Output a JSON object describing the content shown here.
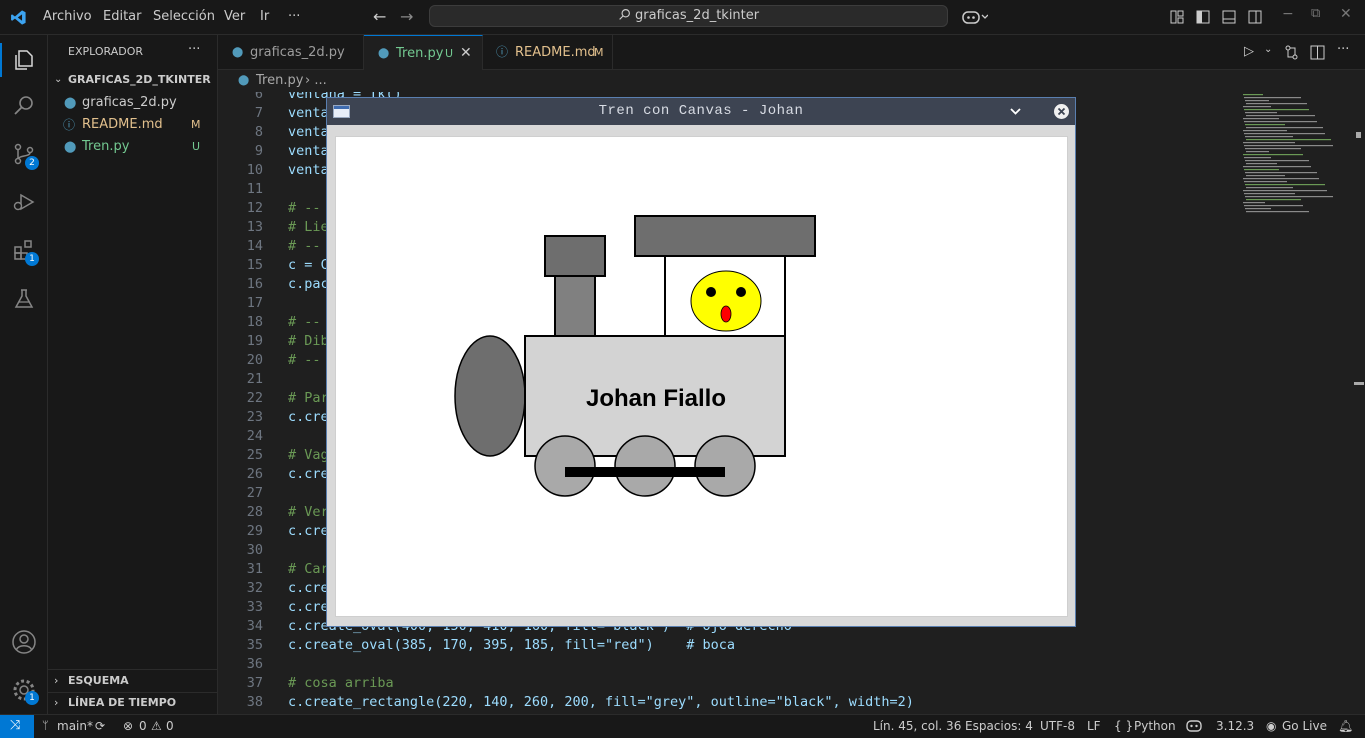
{
  "menu": [
    "Archivo",
    "Editar",
    "Selección",
    "Ver",
    "Ir",
    "···"
  ],
  "search_text": "graficas_2d_tkinter",
  "activity_badges": {
    "source_control": "2",
    "extensions": "1",
    "settings": "1"
  },
  "sidebar": {
    "title": "EXPLORADOR",
    "more": "···",
    "folder": "GRAFICAS_2D_TKINTER",
    "files": [
      {
        "name": "graficas_2d.py",
        "status": ""
      },
      {
        "name": "README.md",
        "status": "M"
      },
      {
        "name": "Tren.py",
        "status": "U"
      }
    ],
    "outline": "ESQUEMA",
    "timeline": "LÍNEA DE TIEMPO"
  },
  "tabs": [
    {
      "label": "graficas_2d.py",
      "status": ""
    },
    {
      "label": "Tren.py",
      "status": "U"
    },
    {
      "label": "README.md",
      "status": "M"
    }
  ],
  "breadcrumb": {
    "file": "Tren.py",
    "sep": "› ..."
  },
  "lines": [
    {
      "num": "6",
      "text": "ventana = Tk()"
    },
    {
      "num": "7",
      "text": "venta"
    },
    {
      "num": "8",
      "text": "venta"
    },
    {
      "num": "9",
      "text": "venta"
    },
    {
      "num": "10",
      "text": "venta"
    },
    {
      "num": "11",
      "text": ""
    },
    {
      "num": "12",
      "text": "# --"
    },
    {
      "num": "13",
      "text": "# Lie"
    },
    {
      "num": "14",
      "text": "# --"
    },
    {
      "num": "15",
      "text": "c = C"
    },
    {
      "num": "16",
      "text": "c.pac"
    },
    {
      "num": "17",
      "text": ""
    },
    {
      "num": "18",
      "text": "# --"
    },
    {
      "num": "19",
      "text": "# Dib"
    },
    {
      "num": "20",
      "text": "# --"
    },
    {
      "num": "21",
      "text": ""
    },
    {
      "num": "22",
      "text": "# Par"
    },
    {
      "num": "23",
      "text": "c.cre"
    },
    {
      "num": "24",
      "text": ""
    },
    {
      "num": "25",
      "text": "# Vag"
    },
    {
      "num": "26",
      "text": "c.cre"
    },
    {
      "num": "27",
      "text": ""
    },
    {
      "num": "28",
      "text": "# Ver"
    },
    {
      "num": "29",
      "text": "c.cre"
    },
    {
      "num": "30",
      "text": ""
    },
    {
      "num": "31",
      "text": "# Car"
    },
    {
      "num": "32",
      "text": "c.cre"
    },
    {
      "num": "33",
      "text": "c.cre"
    },
    {
      "num": "34",
      "text": "c.create_oval(400, 150, 410, 160, fill=\"black\")  # ojo derecho"
    },
    {
      "num": "35",
      "text": "c.create_oval(385, 170, 395, 185, fill=\"red\")    # boca"
    },
    {
      "num": "36",
      "text": ""
    },
    {
      "num": "37",
      "text": "# cosa arriba"
    },
    {
      "num": "38",
      "text": "c.create_rectangle(220, 140, 260, 200, fill=\"grey\", outline=\"black\", width=2)"
    }
  ],
  "tk_window": {
    "title": "Tren con Canvas - Johan",
    "label": "Johan Fiallo"
  },
  "status": {
    "branch": "main*",
    "errors": "0",
    "warnings": "0",
    "position": "Lín. 45, col. 36",
    "spaces": "Espacios: 4",
    "encoding": "UTF-8",
    "eol": "LF",
    "language": "Python",
    "version": "3.12.3",
    "golive": "Go Live"
  },
  "colors": {
    "accent": "#0078d4",
    "modified": "#e2c08d",
    "untracked": "#73c991",
    "comment": "#6a9955"
  }
}
